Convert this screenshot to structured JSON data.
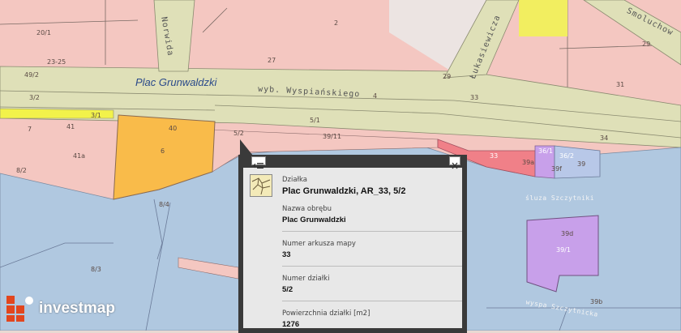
{
  "map": {
    "place_label": "Plac Grunwaldzki",
    "streets": {
      "norwida": "Norwida",
      "wyspianskiego": "wyb. Wyspiańskiego",
      "lukasiewicza": "Łukasiewicza",
      "smoluchowskiego": "Smoluchow",
      "sluza": "śluza Szczytniki",
      "wyspa": "wyspa Szczytnicka"
    },
    "parcel_labels": {
      "l20_1": "20/1",
      "l23_25": "23-25",
      "l2": "2",
      "l27": "27",
      "l49_2": "49/2",
      "l29a": "29",
      "l29b": "29",
      "l31": "31",
      "l3_2": "3/2",
      "l4": "4",
      "l33": "33",
      "l3_1": "3/1",
      "l41": "41",
      "l7": "7",
      "l40": "40",
      "l6": "6",
      "l41a": "41a",
      "l8_2": "8/2",
      "l5_1": "5/1",
      "l5_2": "5/2",
      "l39_11": "39/11",
      "l34": "34",
      "l33r": "33",
      "l39a": "39a",
      "l36_1": "36/1",
      "l36_2": "36/2",
      "l39": "39",
      "l39f": "39f",
      "l8_4": "8/4",
      "l8_3": "8/3",
      "l39d": "39d",
      "l39_1": "39/1",
      "l39b": "39b"
    },
    "colors": {
      "residential": "#f4c7c1",
      "road": "#dfe0b8",
      "water": "#b0c8e0",
      "selected": "#f9bb4a",
      "red_parcel": "#f08088",
      "purple_parcel": "#c8a0ea",
      "yellow_strip": "#f2f24a"
    }
  },
  "popup": {
    "type_label": "Działka",
    "title": "Plac Grunwaldzki, AR_33, 5/2",
    "fields": [
      {
        "label": "Nazwa obrębu",
        "value": "Plac Grunwaldzki"
      },
      {
        "label": "Numer arkusza mapy",
        "value": "33"
      },
      {
        "label": "Numer działki",
        "value": "5/2"
      },
      {
        "label": "Powierzchnia działki [m2]",
        "value": "1276"
      }
    ],
    "menu_icon": "list-icon",
    "close_icon": "close-icon",
    "thumbnail_icon": "parcel-map-thumbnail"
  },
  "logo": {
    "text": "investmap",
    "icon": "investmap-logo-icon"
  }
}
